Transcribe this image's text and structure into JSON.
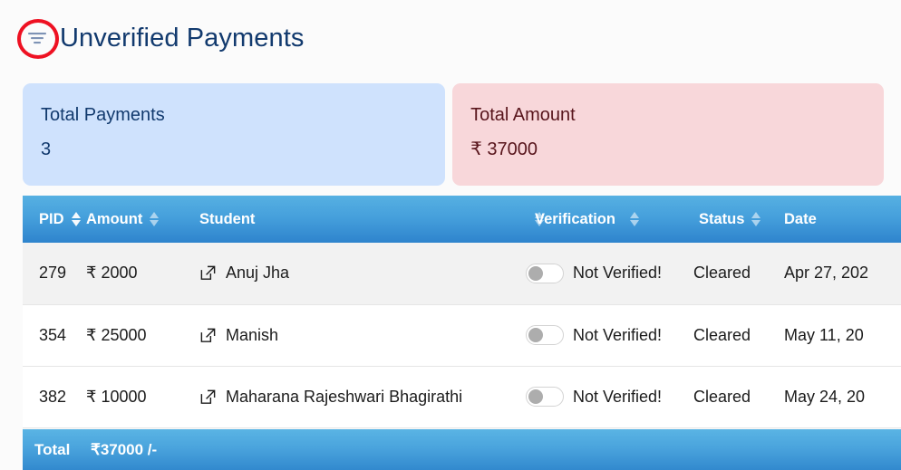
{
  "header": {
    "filter_icon": "filter-lines-icon",
    "title": "Unverified Payments",
    "annotation_color": "#ee1122"
  },
  "cards": [
    {
      "name": "total-payments",
      "label": "Total Payments",
      "value": "3",
      "bg": "#cfe2fd",
      "fg": "#123a6e"
    },
    {
      "name": "total-amount",
      "label": "Total Amount",
      "value": "₹ 37000",
      "bg": "#f8d7da",
      "fg": "#58151c"
    }
  ],
  "table": {
    "columns": [
      {
        "label": "PID",
        "sortable": true,
        "sort_active": true
      },
      {
        "label": "Amount",
        "sortable": true,
        "sort_active": false
      },
      {
        "label": "Student",
        "sortable": true,
        "sort_active": false
      },
      {
        "label": "Verification",
        "sortable": true,
        "sort_active": false
      },
      {
        "label": "Status",
        "sortable": true,
        "sort_active": false
      },
      {
        "label": "Date",
        "sortable": false,
        "sort_active": false
      }
    ],
    "rows": [
      {
        "pid": "279",
        "amount": "₹ 2000",
        "student": "Anuj Jha",
        "student_link_icon": "external-link-icon",
        "verification_toggle": "off",
        "verification": "Not Verified!",
        "status": "Cleared",
        "date": "Apr 27, 202"
      },
      {
        "pid": "354",
        "amount": "₹ 25000",
        "student": "Manish",
        "student_link_icon": "external-link-icon",
        "verification_toggle": "off",
        "verification": "Not Verified!",
        "status": "Cleared",
        "date": "May 11, 20"
      },
      {
        "pid": "382",
        "amount": "₹ 10000",
        "student": "Maharana Rajeshwari Bhagirathi",
        "student_link_icon": "external-link-icon",
        "verification_toggle": "off",
        "verification": "Not Verified!",
        "status": "Cleared",
        "date": "May 24, 20"
      }
    ],
    "footer": {
      "label": "Total",
      "value": "₹37000 /-"
    },
    "header_bg": "#46a0dc"
  }
}
